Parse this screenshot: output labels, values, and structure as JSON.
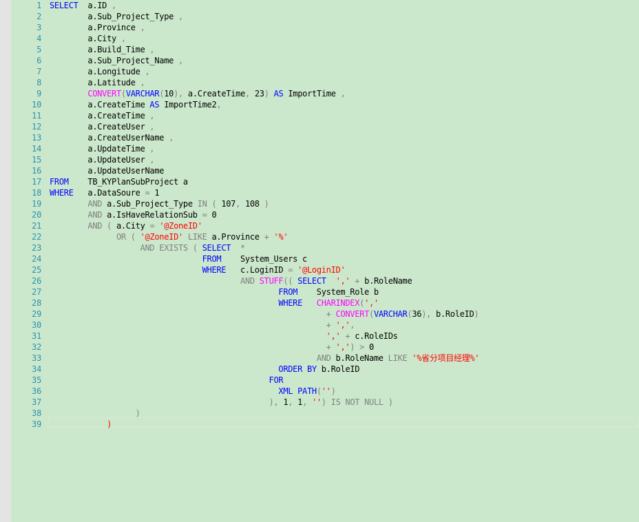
{
  "colors": {
    "background": "#cce8cc",
    "line_number": "#2b91af",
    "keyword": "#0000ff",
    "function": "#ff00ff",
    "operator": "#808080",
    "string": "#ff0000",
    "text": "#000000"
  },
  "lines": [
    {
      "n": "1",
      "tokens": [
        [
          "kw",
          "SELECT"
        ],
        [
          "tx",
          "  a.ID "
        ],
        [
          "op",
          ","
        ]
      ]
    },
    {
      "n": "2",
      "tokens": [
        [
          "tx",
          "        a.Sub_Project_Type "
        ],
        [
          "op",
          ","
        ]
      ]
    },
    {
      "n": "3",
      "tokens": [
        [
          "tx",
          "        a.Province "
        ],
        [
          "op",
          ","
        ]
      ]
    },
    {
      "n": "4",
      "tokens": [
        [
          "tx",
          "        a.City "
        ],
        [
          "op",
          ","
        ]
      ]
    },
    {
      "n": "5",
      "tokens": [
        [
          "tx",
          "        a.Build_Time "
        ],
        [
          "op",
          ","
        ]
      ]
    },
    {
      "n": "6",
      "tokens": [
        [
          "tx",
          "        a.Sub_Project_Name "
        ],
        [
          "op",
          ","
        ]
      ]
    },
    {
      "n": "7",
      "tokens": [
        [
          "tx",
          "        a.Longitude "
        ],
        [
          "op",
          ","
        ]
      ]
    },
    {
      "n": "8",
      "tokens": [
        [
          "tx",
          "        a.Latitude "
        ],
        [
          "op",
          ","
        ]
      ]
    },
    {
      "n": "9",
      "tokens": [
        [
          "tx",
          "        "
        ],
        [
          "fn",
          "CONVERT"
        ],
        [
          "op",
          "("
        ],
        [
          "kw",
          "VARCHAR"
        ],
        [
          "op",
          "("
        ],
        [
          "tx",
          "10"
        ],
        [
          "op",
          "),"
        ],
        [
          "tx",
          " a.CreateTime"
        ],
        [
          "op",
          ","
        ],
        [
          "tx",
          " 23"
        ],
        [
          "op",
          ")"
        ],
        [
          "tx",
          " "
        ],
        [
          "kw",
          "AS"
        ],
        [
          "tx",
          " ImportTime "
        ],
        [
          "op",
          ","
        ]
      ]
    },
    {
      "n": "10",
      "tokens": [
        [
          "tx",
          "        a.CreateTime "
        ],
        [
          "kw",
          "AS"
        ],
        [
          "tx",
          " ImportTime2"
        ],
        [
          "op",
          ","
        ]
      ]
    },
    {
      "n": "11",
      "tokens": [
        [
          "tx",
          "        a.CreateTime "
        ],
        [
          "op",
          ","
        ]
      ]
    },
    {
      "n": "12",
      "tokens": [
        [
          "tx",
          "        a.CreateUser "
        ],
        [
          "op",
          ","
        ]
      ]
    },
    {
      "n": "13",
      "tokens": [
        [
          "tx",
          "        a.CreateUserName "
        ],
        [
          "op",
          ","
        ]
      ]
    },
    {
      "n": "14",
      "tokens": [
        [
          "tx",
          "        a.UpdateTime "
        ],
        [
          "op",
          ","
        ]
      ]
    },
    {
      "n": "15",
      "tokens": [
        [
          "tx",
          "        a.UpdateUser "
        ],
        [
          "op",
          ","
        ]
      ]
    },
    {
      "n": "16",
      "tokens": [
        [
          "tx",
          "        a.UpdateUserName"
        ]
      ]
    },
    {
      "n": "17",
      "tokens": [
        [
          "kw",
          "FROM"
        ],
        [
          "tx",
          "    TB_KYPlanSubProject a"
        ]
      ]
    },
    {
      "n": "18",
      "tokens": [
        [
          "kw",
          "WHERE"
        ],
        [
          "tx",
          "   a.DataSoure "
        ],
        [
          "op",
          "="
        ],
        [
          "tx",
          " 1"
        ]
      ]
    },
    {
      "n": "19",
      "tokens": [
        [
          "tx",
          "        "
        ],
        [
          "op",
          "AND"
        ],
        [
          "tx",
          " a.Sub_Project_Type "
        ],
        [
          "op",
          "IN ("
        ],
        [
          "tx",
          " 107"
        ],
        [
          "op",
          ","
        ],
        [
          "tx",
          " 108 "
        ],
        [
          "op",
          ")"
        ]
      ]
    },
    {
      "n": "20",
      "tokens": [
        [
          "tx",
          "        "
        ],
        [
          "op",
          "AND"
        ],
        [
          "tx",
          " a.IsHaveRelationSub "
        ],
        [
          "op",
          "="
        ],
        [
          "tx",
          " 0"
        ]
      ]
    },
    {
      "n": "21",
      "tokens": [
        [
          "tx",
          "        "
        ],
        [
          "op",
          "AND ("
        ],
        [
          "tx",
          " a.City "
        ],
        [
          "op",
          "="
        ],
        [
          "tx",
          " "
        ],
        [
          "st",
          "'@ZoneID'"
        ]
      ]
    },
    {
      "n": "22",
      "tokens": [
        [
          "tx",
          "              "
        ],
        [
          "op",
          "OR ("
        ],
        [
          "tx",
          " "
        ],
        [
          "st",
          "'@ZoneID'"
        ],
        [
          "tx",
          " "
        ],
        [
          "op",
          "LIKE"
        ],
        [
          "tx",
          " a.Province "
        ],
        [
          "op",
          "+"
        ],
        [
          "tx",
          " "
        ],
        [
          "st",
          "'%'"
        ]
      ]
    },
    {
      "n": "23",
      "tokens": [
        [
          "tx",
          "                   "
        ],
        [
          "op",
          "AND EXISTS ("
        ],
        [
          "tx",
          " "
        ],
        [
          "kw",
          "SELECT"
        ],
        [
          "tx",
          "  "
        ],
        [
          "op",
          "*"
        ]
      ]
    },
    {
      "n": "24",
      "tokens": [
        [
          "tx",
          "                                "
        ],
        [
          "kw",
          "FROM"
        ],
        [
          "tx",
          "    System_Users c"
        ]
      ]
    },
    {
      "n": "25",
      "tokens": [
        [
          "tx",
          "                                "
        ],
        [
          "kw",
          "WHERE"
        ],
        [
          "tx",
          "   c.LoginID "
        ],
        [
          "op",
          "="
        ],
        [
          "tx",
          " "
        ],
        [
          "st",
          "'@LoginID'"
        ]
      ]
    },
    {
      "n": "26",
      "tokens": [
        [
          "tx",
          "                                        "
        ],
        [
          "op",
          "AND"
        ],
        [
          "tx",
          " "
        ],
        [
          "fn",
          "STUFF"
        ],
        [
          "op",
          "(("
        ],
        [
          "tx",
          " "
        ],
        [
          "kw",
          "SELECT"
        ],
        [
          "tx",
          "  "
        ],
        [
          "st",
          "','"
        ],
        [
          "tx",
          " "
        ],
        [
          "op",
          "+"
        ],
        [
          "tx",
          " b.RoleName"
        ]
      ]
    },
    {
      "n": "27",
      "tokens": [
        [
          "tx",
          "                                                "
        ],
        [
          "kw",
          "FROM"
        ],
        [
          "tx",
          "    System_Role b"
        ]
      ]
    },
    {
      "n": "28",
      "tokens": [
        [
          "tx",
          "                                                "
        ],
        [
          "kw",
          "WHERE"
        ],
        [
          "tx",
          "   "
        ],
        [
          "fn",
          "CHARINDEX"
        ],
        [
          "op",
          "("
        ],
        [
          "st",
          "','"
        ]
      ]
    },
    {
      "n": "29",
      "tokens": [
        [
          "tx",
          "                                                          "
        ],
        [
          "op",
          "+"
        ],
        [
          "tx",
          " "
        ],
        [
          "fn",
          "CONVERT"
        ],
        [
          "op",
          "("
        ],
        [
          "kw",
          "VARCHAR"
        ],
        [
          "op",
          "("
        ],
        [
          "tx",
          "36"
        ],
        [
          "op",
          "),"
        ],
        [
          "tx",
          " b.RoleID"
        ],
        [
          "op",
          ")"
        ]
      ]
    },
    {
      "n": "30",
      "tokens": [
        [
          "tx",
          "                                                          "
        ],
        [
          "op",
          "+"
        ],
        [
          "tx",
          " "
        ],
        [
          "st",
          "','"
        ],
        [
          "op",
          ","
        ]
      ]
    },
    {
      "n": "31",
      "tokens": [
        [
          "tx",
          "                                                          "
        ],
        [
          "st",
          "','"
        ],
        [
          "tx",
          " "
        ],
        [
          "op",
          "+"
        ],
        [
          "tx",
          " c.RoleIDs"
        ]
      ]
    },
    {
      "n": "32",
      "tokens": [
        [
          "tx",
          "                                                          "
        ],
        [
          "op",
          "+"
        ],
        [
          "tx",
          " "
        ],
        [
          "st",
          "','"
        ],
        [
          "op",
          ") >"
        ],
        [
          "tx",
          " 0"
        ]
      ]
    },
    {
      "n": "33",
      "tokens": [
        [
          "tx",
          "                                                        "
        ],
        [
          "op",
          "AND"
        ],
        [
          "tx",
          " b.RoleName "
        ],
        [
          "op",
          "LIKE"
        ],
        [
          "tx",
          " "
        ],
        [
          "st",
          "'%省分项目经理%'"
        ]
      ]
    },
    {
      "n": "34",
      "tokens": [
        [
          "tx",
          "                                                "
        ],
        [
          "kw",
          "ORDER BY"
        ],
        [
          "tx",
          " b.RoleID"
        ]
      ]
    },
    {
      "n": "35",
      "tokens": [
        [
          "tx",
          "                                              "
        ],
        [
          "kw",
          "FOR"
        ]
      ]
    },
    {
      "n": "36",
      "tokens": [
        [
          "tx",
          "                                                "
        ],
        [
          "kw",
          "XML"
        ],
        [
          "tx",
          " "
        ],
        [
          "kw",
          "PATH"
        ],
        [
          "op",
          "("
        ],
        [
          "st",
          "''"
        ],
        [
          "op",
          ")"
        ]
      ]
    },
    {
      "n": "37",
      "tokens": [
        [
          "tx",
          "                                              "
        ],
        [
          "op",
          "),"
        ],
        [
          "tx",
          " 1"
        ],
        [
          "op",
          ","
        ],
        [
          "tx",
          " 1"
        ],
        [
          "op",
          ","
        ],
        [
          "tx",
          " "
        ],
        [
          "st",
          "''"
        ],
        [
          "op",
          ") IS NOT NULL )"
        ]
      ]
    },
    {
      "n": "38",
      "tokens": [
        [
          "tx",
          "                  "
        ],
        [
          "op",
          ")"
        ]
      ]
    },
    {
      "n": "39",
      "tokens": [
        [
          "tx",
          "            "
        ],
        [
          "st",
          ")"
        ]
      ]
    }
  ]
}
